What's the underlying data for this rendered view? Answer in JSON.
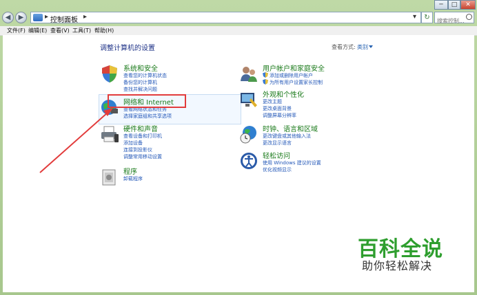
{
  "window": {
    "breadcrumb": "控制面板",
    "search_placeholder": "搜索控制...",
    "controls": {
      "minimize": "─",
      "maximize": "□",
      "close": "✕"
    }
  },
  "menu": [
    "文件(F)",
    "编辑(E)",
    "查看(V)",
    "工具(T)",
    "帮助(H)"
  ],
  "main": {
    "heading": "调整计算机的设置",
    "view_by_label": "查看方式:",
    "view_by_value": "类别"
  },
  "categories_left": [
    {
      "title": "系统和安全",
      "links": [
        "查看您的计算机状态",
        "备份您的计算机",
        "查找并解决问题"
      ]
    },
    {
      "title": "网络和 Internet",
      "links": [
        "查看网络状态和任务",
        "选择家庭组和共享选项"
      ]
    },
    {
      "title": "硬件和声音",
      "links": [
        "查看设备和打印机",
        "添加设备",
        "连接到投影仪",
        "调整常用移动设置"
      ]
    },
    {
      "title": "程序",
      "links": [
        "卸载程序"
      ]
    }
  ],
  "categories_right": [
    {
      "title": "用户帐户和家庭安全",
      "links": [
        "添加或删除用户帐户",
        "为所有用户设置家长控制"
      ]
    },
    {
      "title": "外观和个性化",
      "links": [
        "更改主题",
        "更改桌面背景",
        "调整屏幕分辨率"
      ]
    },
    {
      "title": "时钟、语言和区域",
      "links": [
        "更改键盘或其他输入法",
        "更改显示语言"
      ]
    },
    {
      "title": "轻松访问",
      "links": [
        "使用 Windows 建议的设置",
        "优化视频显示"
      ]
    }
  ],
  "watermark": {
    "main": "百科全说",
    "sub": "助你轻松解决"
  },
  "colors": {
    "link": "#2458b8",
    "category_title": "#1a7a1a",
    "highlight": "#e23b3b",
    "watermark": "#2e9e2e"
  }
}
